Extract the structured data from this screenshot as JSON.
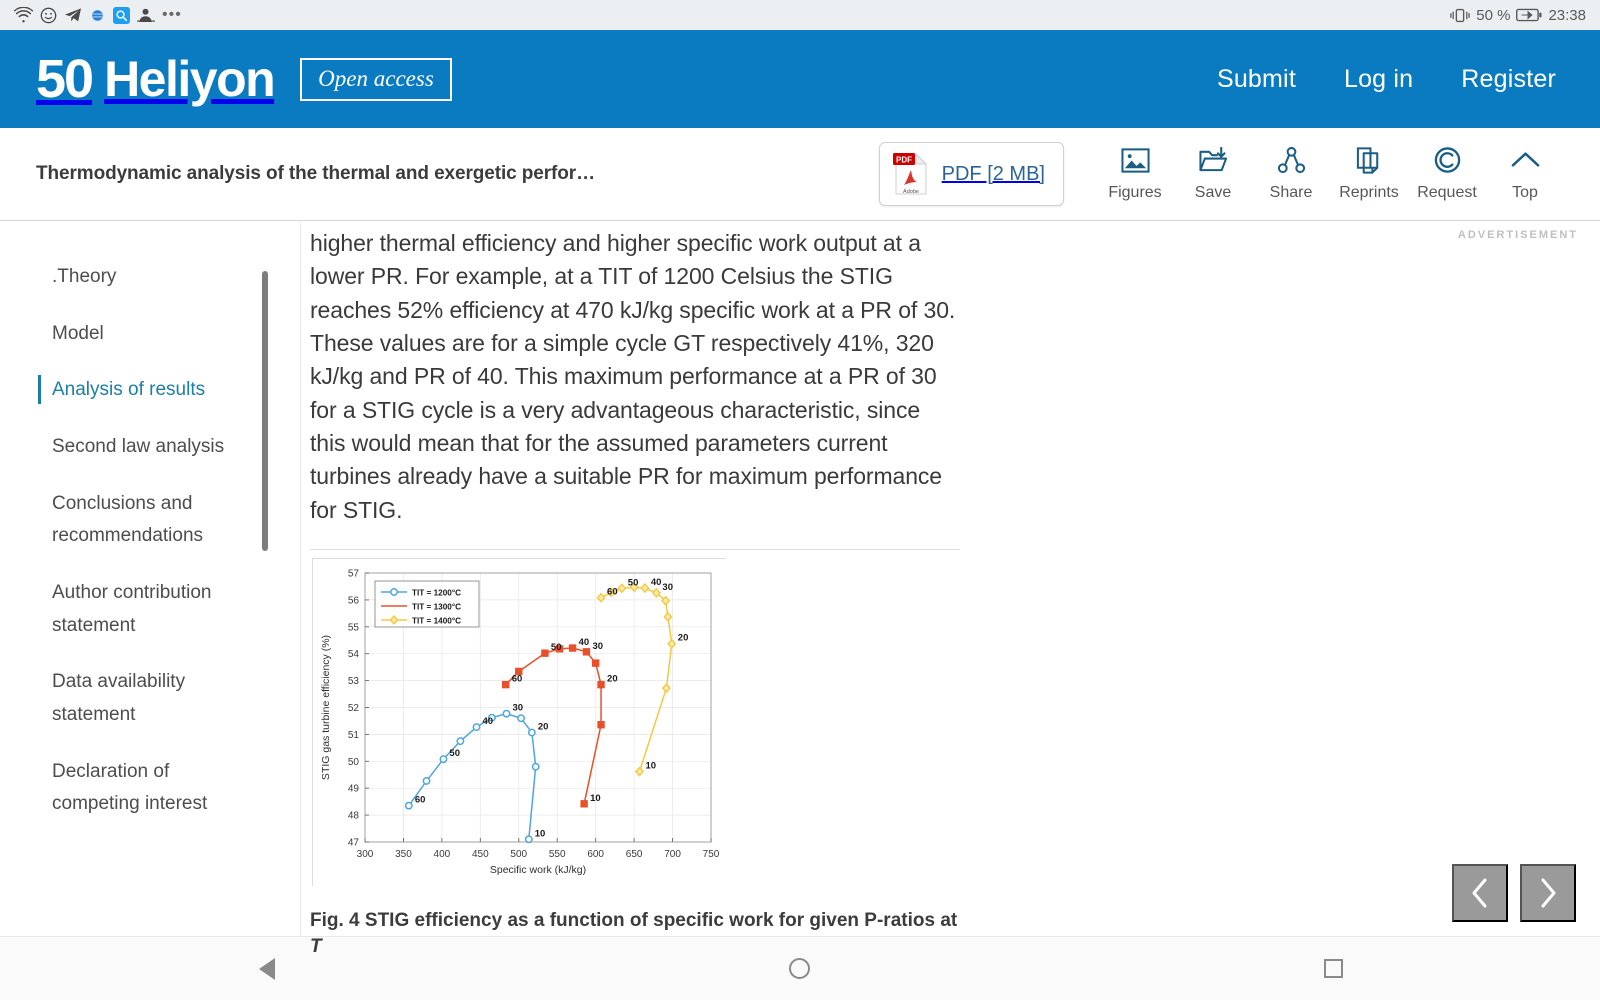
{
  "statusbar": {
    "icons": [
      "wifi-icon",
      "smiley-icon",
      "telegram-icon",
      "globe-icon",
      "search-icon",
      "person-icon"
    ],
    "overflow": "•••",
    "battery_percent": "50 %",
    "time": "23:38"
  },
  "brandbar": {
    "logo_number": "50",
    "logo_name": "Heliyon",
    "open_access_badge": "Open access",
    "links": [
      {
        "label": "Submit",
        "name": "submit-link"
      },
      {
        "label": "Log in",
        "name": "login-link"
      },
      {
        "label": "Register",
        "name": "register-link"
      }
    ]
  },
  "actionbar": {
    "article_title": "Thermodynamic analysis of the thermal and exergetic perfor…",
    "pdf_label": "PDF [2 MB]",
    "pdf_badge": "PDF",
    "pdf_brand": "Adobe",
    "tools": [
      {
        "label": "Figures",
        "icon": "figures-icon"
      },
      {
        "label": "Save",
        "icon": "save-folder-icon"
      },
      {
        "label": "Share",
        "icon": "share-nodes-icon"
      },
      {
        "label": "Reprints",
        "icon": "reprints-document-icon"
      },
      {
        "label": "Request",
        "icon": "copyright-icon"
      },
      {
        "label": "Top",
        "icon": "chevron-up-icon"
      }
    ]
  },
  "sidebar": {
    "items": [
      {
        "label": ".Theory",
        "active": false
      },
      {
        "label": "Model",
        "active": false
      },
      {
        "label": "Analysis of results",
        "active": true
      },
      {
        "label": "Second law analysis",
        "active": false
      },
      {
        "label": "Conclusions and recommendations",
        "active": false
      },
      {
        "label": "Author contribution statement",
        "active": false
      },
      {
        "label": "Data availability statement",
        "active": false
      },
      {
        "label": "Declaration of competing interest",
        "active": false
      }
    ]
  },
  "main": {
    "paragraph": "higher thermal efficiency and higher specific work output at a lower PR. For example, at a TIT of 1200 Celsius the STIG reaches 52% efficiency at 470 kJ/kg specific work at a PR of 30. These values are for a simple cycle GT respectively 41%, 320 kJ/kg and PR of 40. This maximum performance at a PR of 30 for a STIG cycle is a very advantageous characteristic, since this would mean that for the assumed parameters current turbines already have a suitable PR for maximum performance for STIG.",
    "figure_caption_prefix": "Fig. 4",
    "figure_caption_text": "STIG efficiency as a function of specific work for given P-ratios at ",
    "figure_caption_italic": "T"
  },
  "rightrail": {
    "ad_label": "ADVERTISEMENT",
    "prev_label": "‹",
    "next_label": "›"
  },
  "androidnav": {
    "back": "back-triangle-icon",
    "home": "home-circle-icon",
    "recents": "recents-square-icon"
  },
  "colors": {
    "brand_blue": "#0b7bc1",
    "accent_teal": "#1a7fa8",
    "series_1200": "#4da6dd",
    "series_1300": "#e8502a",
    "series_1400": "#f5c842"
  },
  "chart_data": {
    "type": "line",
    "title": "",
    "xlabel": "Specific work (kJ/kg)",
    "ylabel": "STIG gas turbine efficiency (%)",
    "xlim": [
      300,
      750
    ],
    "ylim": [
      47,
      57
    ],
    "xticks": [
      300,
      350,
      400,
      450,
      500,
      550,
      600,
      650,
      700,
      750
    ],
    "yticks": [
      47,
      48,
      49,
      50,
      51,
      52,
      53,
      54,
      55,
      56,
      57
    ],
    "grid": true,
    "legend_position": "top-left",
    "point_labels": [
      60,
      50,
      40,
      30,
      20,
      10
    ],
    "series": [
      {
        "name": "TIT = 1200°C",
        "color": "#4da6dd",
        "marker": "circle",
        "points": [
          {
            "x": 357,
            "y": 48.35,
            "pr": 60
          },
          {
            "x": 380,
            "y": 49.27,
            "pr": null
          },
          {
            "x": 402,
            "y": 50.08,
            "pr": 50
          },
          {
            "x": 424,
            "y": 50.75,
            "pr": null
          },
          {
            "x": 445,
            "y": 51.27,
            "pr": 40
          },
          {
            "x": 465,
            "y": 51.62,
            "pr": null
          },
          {
            "x": 484,
            "y": 51.77,
            "pr": 30
          },
          {
            "x": 503,
            "y": 51.6,
            "pr": null
          },
          {
            "x": 517,
            "y": 51.07,
            "pr": 20
          },
          {
            "x": 522,
            "y": 49.8,
            "pr": null
          },
          {
            "x": 513,
            "y": 47.1,
            "pr": 10
          }
        ]
      },
      {
        "name": "TIT = 1300°C",
        "color": "#e8502a",
        "marker": "square",
        "points": [
          {
            "x": 483,
            "y": 52.85,
            "pr": 60
          },
          {
            "x": 500,
            "y": 53.34,
            "pr": null
          },
          {
            "x": 534,
            "y": 54.02,
            "pr": 50
          },
          {
            "x": 553,
            "y": 54.18,
            "pr": null
          },
          {
            "x": 570,
            "y": 54.21,
            "pr": 40
          },
          {
            "x": 588,
            "y": 54.07,
            "pr": 30
          },
          {
            "x": 600,
            "y": 53.65,
            "pr": null
          },
          {
            "x": 607,
            "y": 52.85,
            "pr": 20
          },
          {
            "x": 607,
            "y": 51.36,
            "pr": null
          },
          {
            "x": 585,
            "y": 48.42,
            "pr": 10
          }
        ]
      },
      {
        "name": "TIT = 1400°C",
        "color": "#f5c842",
        "marker": "diamond",
        "points": [
          {
            "x": 607,
            "y": 56.08,
            "pr": 60
          },
          {
            "x": 620,
            "y": 56.28,
            "pr": null
          },
          {
            "x": 634,
            "y": 56.43,
            "pr": 50
          },
          {
            "x": 650,
            "y": 56.47,
            "pr": null
          },
          {
            "x": 664,
            "y": 56.44,
            "pr": 40
          },
          {
            "x": 679,
            "y": 56.26,
            "pr": 30
          },
          {
            "x": 691,
            "y": 55.97,
            "pr": null
          },
          {
            "x": 694,
            "y": 55.37,
            "pr": null
          },
          {
            "x": 699,
            "y": 54.37,
            "pr": 20
          },
          {
            "x": 692,
            "y": 52.72,
            "pr": null
          },
          {
            "x": 657,
            "y": 49.62,
            "pr": 10
          }
        ]
      }
    ]
  }
}
